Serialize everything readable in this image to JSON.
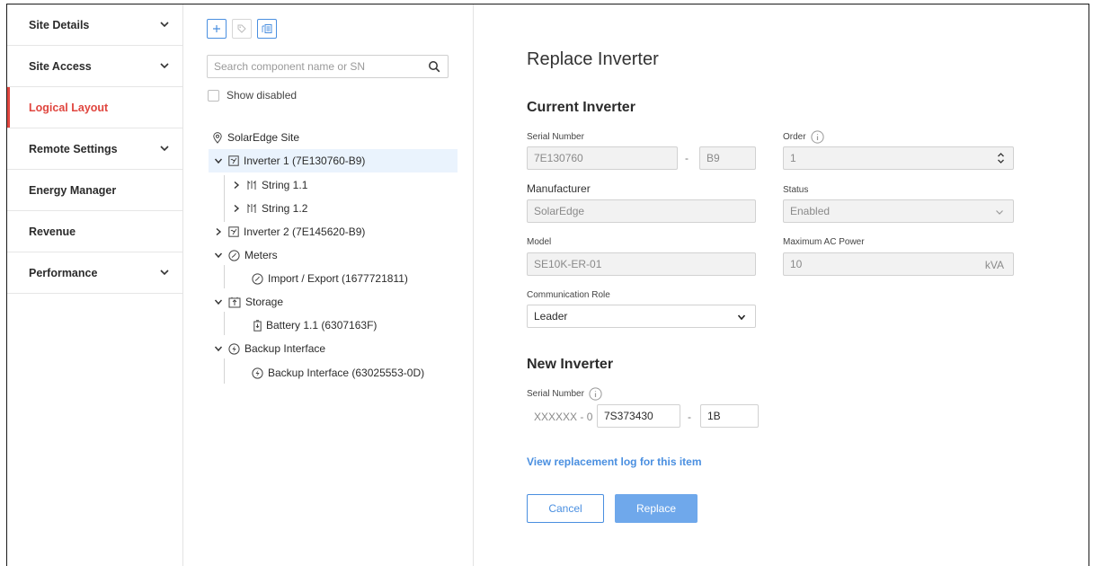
{
  "sidebar": {
    "items": [
      {
        "label": "Site Details",
        "has_chevron": true
      },
      {
        "label": "Site Access",
        "has_chevron": true
      },
      {
        "label": "Logical Layout",
        "active": true
      },
      {
        "label": "Remote Settings",
        "has_chevron": true
      },
      {
        "label": "Energy Manager"
      },
      {
        "label": "Revenue"
      },
      {
        "label": "Performance",
        "has_chevron": true
      }
    ]
  },
  "tree_panel": {
    "toolbar_icons": [
      "plus-icon",
      "tag-icon",
      "layout-icon"
    ],
    "search_placeholder": "Search component name or SN",
    "show_disabled_label": "Show disabled",
    "nodes": {
      "site": "SolarEdge Site",
      "inverter1": "Inverter 1 (7E130760-B9)",
      "string11": "String 1.1",
      "string12": "String 1.2",
      "inverter2": "Inverter 2 (7E145620-B9)",
      "meters": "Meters",
      "import_export": "Import / Export (1677721811)",
      "storage": "Storage",
      "battery": "Battery 1.1 (6307163F)",
      "backup": "Backup Interface",
      "backup_child": "Backup Interface (63025553-0D)"
    }
  },
  "main": {
    "title": "Replace Inverter",
    "current": {
      "heading": "Current Inverter",
      "serial_label": "Serial Number",
      "serial_value": "7E130760",
      "serial_suffix": "B9",
      "dash": "-",
      "order_label": "Order",
      "order_value": "1",
      "manufacturer_label": "Manufacturer",
      "manufacturer_value": "SolarEdge",
      "status_label": "Status",
      "status_value": "Enabled",
      "model_label": "Model",
      "model_value": "SE10K-ER-01",
      "max_ac_label": "Maximum AC Power",
      "max_ac_value": "10",
      "max_ac_unit": "kVA",
      "comm_role_label": "Communication Role",
      "comm_role_value": "Leader"
    },
    "new": {
      "heading": "New Inverter",
      "serial_label": "Serial Number",
      "prefix": "XXXXXX - 0",
      "serial_value": "7S373430",
      "dash": "-",
      "suffix_value": "1B"
    },
    "log_link": "View replacement log for this item",
    "cancel_label": "Cancel",
    "replace_label": "Replace"
  },
  "colors": {
    "accent": "#4a8fe0",
    "active_red": "#e0463f",
    "selected_row": "#eaf3fd"
  }
}
